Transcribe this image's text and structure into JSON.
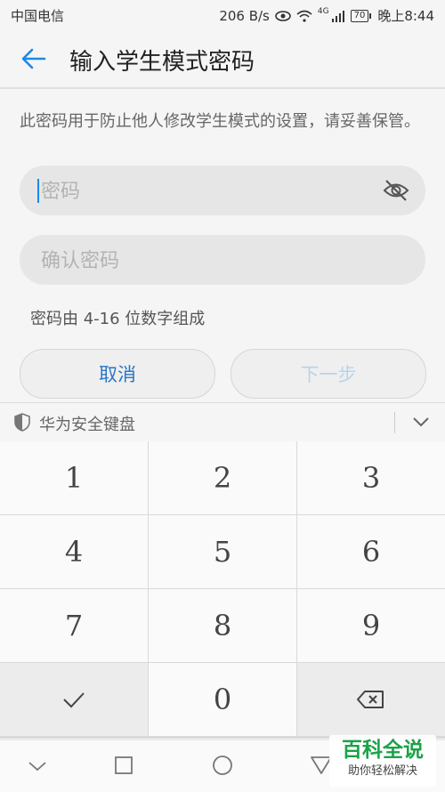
{
  "status_bar": {
    "carrier": "中国电信",
    "network_speed": "206 B/s",
    "signal_label": "4G",
    "battery_level": "70",
    "time": "晚上8:44"
  },
  "app_bar": {
    "back_icon": "arrow-left-icon",
    "title": "输入学生模式密码"
  },
  "form": {
    "description": "此密码用于防止他人修改学生模式的设置，请妥善保管。",
    "password_placeholder": "密码",
    "confirm_placeholder": "确认密码",
    "hint": "密码由 4-16 位数字组成",
    "cancel_label": "取消",
    "next_label": "下一步"
  },
  "keyboard": {
    "title": "华为安全键盘",
    "keys": [
      "1",
      "2",
      "3",
      "4",
      "5",
      "6",
      "7",
      "8",
      "9",
      "0"
    ]
  },
  "watermark": {
    "main": "百科全说",
    "sub": "助你轻松解决"
  },
  "colors": {
    "accent": "#1e88e5",
    "cancel_text": "#2a76c6",
    "next_disabled_text": "#b8d3ee",
    "watermark_green": "#1aa348"
  }
}
